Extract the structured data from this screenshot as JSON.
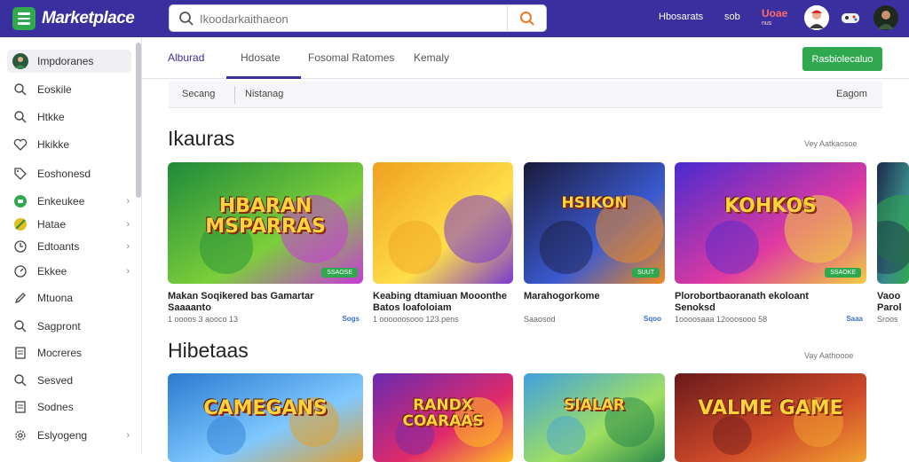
{
  "header": {
    "brand": "Marketplace",
    "search_placeholder": "Ikoodarkaithaeon",
    "links": [
      "Hbosarats",
      "sob"
    ],
    "badge_label": "Uoae",
    "badge_sub": "nus"
  },
  "sidebar": {
    "items": [
      {
        "label": "Impdoranes",
        "icon": "avatar-icon",
        "chevron": false,
        "active": true
      },
      {
        "label": "Eoskile",
        "icon": "search-icon",
        "chevron": false
      },
      {
        "label": "Htkke",
        "icon": "search-icon",
        "chevron": false
      },
      {
        "label": "Hkikke",
        "icon": "heart-icon",
        "chevron": false
      },
      {
        "label": "Eoshonesd",
        "icon": "tag-icon",
        "chevron": false
      },
      {
        "label": "Enkeukee",
        "icon": "green-circle-icon",
        "chevron": true
      },
      {
        "label": "Hatae",
        "icon": "slash-circle-icon",
        "chevron": true
      },
      {
        "label": "Edtoants",
        "icon": "clock-icon",
        "chevron": true
      },
      {
        "label": "Ekkee",
        "icon": "gauge-icon",
        "chevron": true
      },
      {
        "label": "Mtuona",
        "icon": "pencil-icon",
        "chevron": false
      },
      {
        "label": "Sagpront",
        "icon": "search-icon",
        "chevron": false
      },
      {
        "label": "Mocreres",
        "icon": "document-icon",
        "chevron": false
      },
      {
        "label": "Sesved",
        "icon": "search-icon",
        "chevron": false
      },
      {
        "label": "Sodnes",
        "icon": "document-icon",
        "chevron": false
      },
      {
        "label": "Eslyogeng",
        "icon": "gear-icon",
        "chevron": true
      }
    ]
  },
  "tabs": [
    {
      "label": "Alburad",
      "active": true
    },
    {
      "label": "Hdosate",
      "active": false
    },
    {
      "label": "Fosomal Ratomes",
      "active": false
    },
    {
      "label": "Kemaly",
      "active": false
    }
  ],
  "primary_button": "Rasbiolecaluo",
  "filters": {
    "left": "Secang",
    "middle": "Nistanag",
    "right": "Eagom"
  },
  "sections": [
    {
      "title": "Ikauras",
      "view_all": "Vey Aatkaosoe",
      "cards": [
        {
          "thumb_text": "HBARAN MSPARRAS",
          "pill": "SSAOSE",
          "title": "Makan Soqikered bas Gamartar",
          "subtitle": "Saaaanto",
          "meta": "1 oooos 3 aooco 13",
          "price": "Sogs",
          "palette": [
            "#1e8a3a",
            "#7ccf3a",
            "#c83ad8"
          ]
        },
        {
          "thumb_text": "",
          "pill": "",
          "title": "Keabing dtamiuan Mooonthe",
          "subtitle": "Batos loafoloiam",
          "meta": "1 oooooosooo 123 pens",
          "price": "",
          "palette": [
            "#f0a020",
            "#ffdf4a",
            "#7a3ad0"
          ]
        },
        {
          "thumb_text": "HSIKON",
          "pill": "SUUT",
          "title": "Marahogorkome",
          "subtitle": "",
          "meta": "Saaosod",
          "price": "Sqoo",
          "palette": [
            "#1a1a3a",
            "#3a5ad0",
            "#f08a20"
          ]
        },
        {
          "thumb_text": "KOHKOS",
          "pill": "SSAOKE",
          "title": "Plorobortbaoranath ekoloant",
          "subtitle": "Senoksd",
          "meta": "1oooosaaa 12ooosooo 58",
          "price": "Saaa",
          "palette": [
            "#4a2ad0",
            "#e03aa0",
            "#f0d040"
          ]
        },
        {
          "thumb_text": "",
          "pill": "",
          "title": "Vaoo",
          "subtitle": "Parol",
          "meta": "Sroos",
          "price": "",
          "palette": [
            "#1a2a4a",
            "#3a8a8a",
            "#2fa84f"
          ]
        }
      ]
    },
    {
      "title": "Hibetaas",
      "view_all": "Vay Aathoooe",
      "cards": [
        {
          "thumb_text": "CAMEGANS",
          "pill": "",
          "title": "",
          "subtitle": "",
          "meta": "",
          "price": "",
          "palette": [
            "#2a7ad0",
            "#80c8ff",
            "#e0a030"
          ]
        },
        {
          "thumb_text": "RANDX COARAAS",
          "pill": "",
          "title": "",
          "subtitle": "",
          "meta": "",
          "price": "",
          "palette": [
            "#6a2ab0",
            "#e02a6a",
            "#ffc020"
          ]
        },
        {
          "thumb_text": "SIALAR",
          "pill": "",
          "title": "",
          "subtitle": "",
          "meta": "",
          "price": "",
          "palette": [
            "#40a0e0",
            "#a0e060",
            "#2a8a4a"
          ]
        },
        {
          "thumb_text": "VALME GAME",
          "pill": "",
          "title": "",
          "subtitle": "",
          "meta": "",
          "price": "",
          "palette": [
            "#6a1a1a",
            "#d04a2a",
            "#f0a030"
          ]
        }
      ]
    }
  ]
}
